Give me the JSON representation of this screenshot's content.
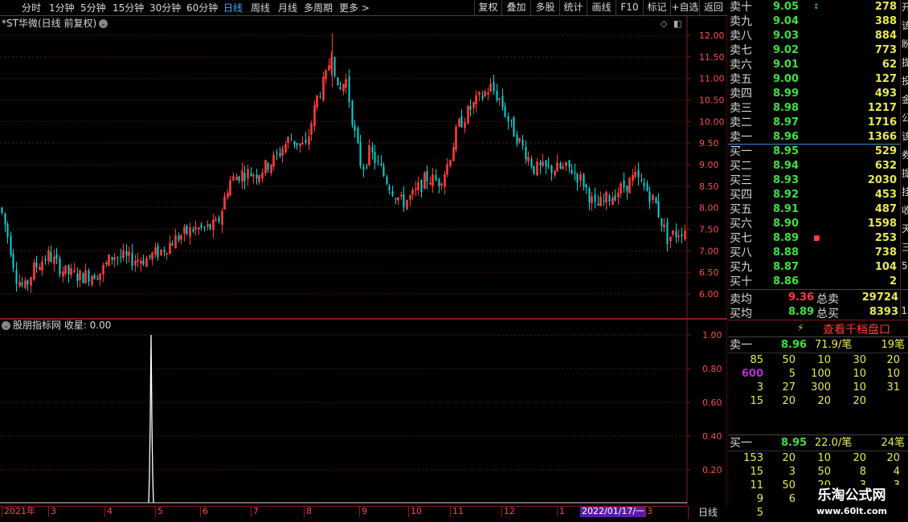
{
  "toolbar": {
    "periods": [
      "分时",
      "1分钟",
      "5分钟",
      "15分钟",
      "30分钟",
      "60分钟",
      "日线",
      "周线",
      "月线",
      "多周期",
      "更多 >"
    ],
    "active_period": "日线",
    "right_buttons": [
      "复权",
      "叠加",
      "多股",
      "统计",
      "画线",
      "F10",
      "标记",
      "+自选",
      "返回"
    ]
  },
  "chart": {
    "title": "*ST华微(日线 前复权)",
    "price_axis": [
      "12.00",
      "11.50",
      "11.00",
      "10.50",
      "10.00",
      "9.50",
      "9.00",
      "8.50",
      "8.00",
      "7.50",
      "7.00",
      "6.50",
      "6.00"
    ],
    "up_color": "#ff3b3b",
    "down_color": "#00d8d8"
  },
  "indicator": {
    "title": "股朋指标网 收星: 0.00",
    "axis": [
      "1.00",
      "0.80",
      "0.60",
      "0.40",
      "0.20"
    ]
  },
  "date_axis": {
    "labels": [
      "2021年",
      "3",
      "4",
      "5",
      "6",
      "7",
      "8",
      "9",
      "10",
      "11",
      "12",
      "1",
      "2022/01/17/一",
      "3"
    ],
    "period_label": "日线"
  },
  "order_book": {
    "sells": [
      {
        "label": "卖十",
        "price": "9.05",
        "volume": "278",
        "mark": "↕"
      },
      {
        "label": "卖九",
        "price": "9.04",
        "volume": "388",
        "mark": ""
      },
      {
        "label": "卖八",
        "price": "9.03",
        "volume": "884",
        "mark": ""
      },
      {
        "label": "卖七",
        "price": "9.02",
        "volume": "773",
        "mark": ""
      },
      {
        "label": "卖六",
        "price": "9.01",
        "volume": "62",
        "mark": ""
      },
      {
        "label": "卖五",
        "price": "9.00",
        "volume": "127",
        "mark": ""
      },
      {
        "label": "卖四",
        "price": "8.99",
        "volume": "493",
        "mark": ""
      },
      {
        "label": "卖三",
        "price": "8.98",
        "volume": "1217",
        "mark": ""
      },
      {
        "label": "卖二",
        "price": "8.97",
        "volume": "1716",
        "mark": ""
      },
      {
        "label": "卖一",
        "price": "8.96",
        "volume": "1366",
        "mark": ""
      }
    ],
    "buys": [
      {
        "label": "买一",
        "price": "8.95",
        "volume": "529",
        "mark": ""
      },
      {
        "label": "买二",
        "price": "8.94",
        "volume": "632",
        "mark": ""
      },
      {
        "label": "买三",
        "price": "8.93",
        "volume": "2030",
        "mark": ""
      },
      {
        "label": "买四",
        "price": "8.92",
        "volume": "453",
        "mark": ""
      },
      {
        "label": "买五",
        "price": "8.91",
        "volume": "487",
        "mark": ""
      },
      {
        "label": "买六",
        "price": "8.90",
        "volume": "1598",
        "mark": ""
      },
      {
        "label": "买七",
        "price": "8.89",
        "volume": "253",
        "mark": "■"
      },
      {
        "label": "买八",
        "price": "8.88",
        "volume": "738",
        "mark": ""
      },
      {
        "label": "买九",
        "price": "8.87",
        "volume": "104",
        "mark": ""
      },
      {
        "label": "买十",
        "price": "8.86",
        "volume": "2",
        "mark": ""
      }
    ],
    "side_chars": [
      "开",
      "该",
      "盼",
      "提",
      "投",
      "金",
      "公",
      "该",
      "券",
      "提",
      "挂",
      "收",
      "天",
      "三",
      "5"
    ]
  },
  "summary": {
    "sell_avg_label": "卖均",
    "sell_avg": "9.36",
    "sell_total_label": "总卖",
    "sell_total": "29724",
    "buy_avg_label": "买均",
    "buy_avg": "8.89",
    "buy_total_label": "总买",
    "buy_total": "8393",
    "side_char": "1"
  },
  "qian_button": "查看千档盘口",
  "queue": {
    "ask": {
      "label": "卖一",
      "price": "8.96",
      "avg": "71.9/笔",
      "count": "19笔",
      "rows": [
        [
          "85",
          "50",
          "10",
          "30",
          "20"
        ],
        [
          "600",
          "5",
          "100",
          "10",
          "10"
        ],
        [
          "3",
          "27",
          "300",
          "10",
          "31"
        ],
        [
          "15",
          "20",
          "20",
          "20",
          ""
        ]
      ]
    },
    "bid": {
      "label": "买一",
      "price": "8.95",
      "avg": "22.0/笔",
      "count": "24笔",
      "rows": [
        [
          "153",
          "20",
          "10",
          "20",
          "20"
        ],
        [
          "15",
          "3",
          "50",
          "8",
          "4"
        ],
        [
          "11",
          "50",
          "20",
          "3",
          "3"
        ],
        [
          "9",
          "6",
          "",
          "",
          ""
        ],
        [
          "5",
          "",
          "",
          "",
          ""
        ]
      ]
    }
  },
  "watermark": {
    "line1": "乐淘公式网",
    "line2": "www.60lt.com"
  }
}
